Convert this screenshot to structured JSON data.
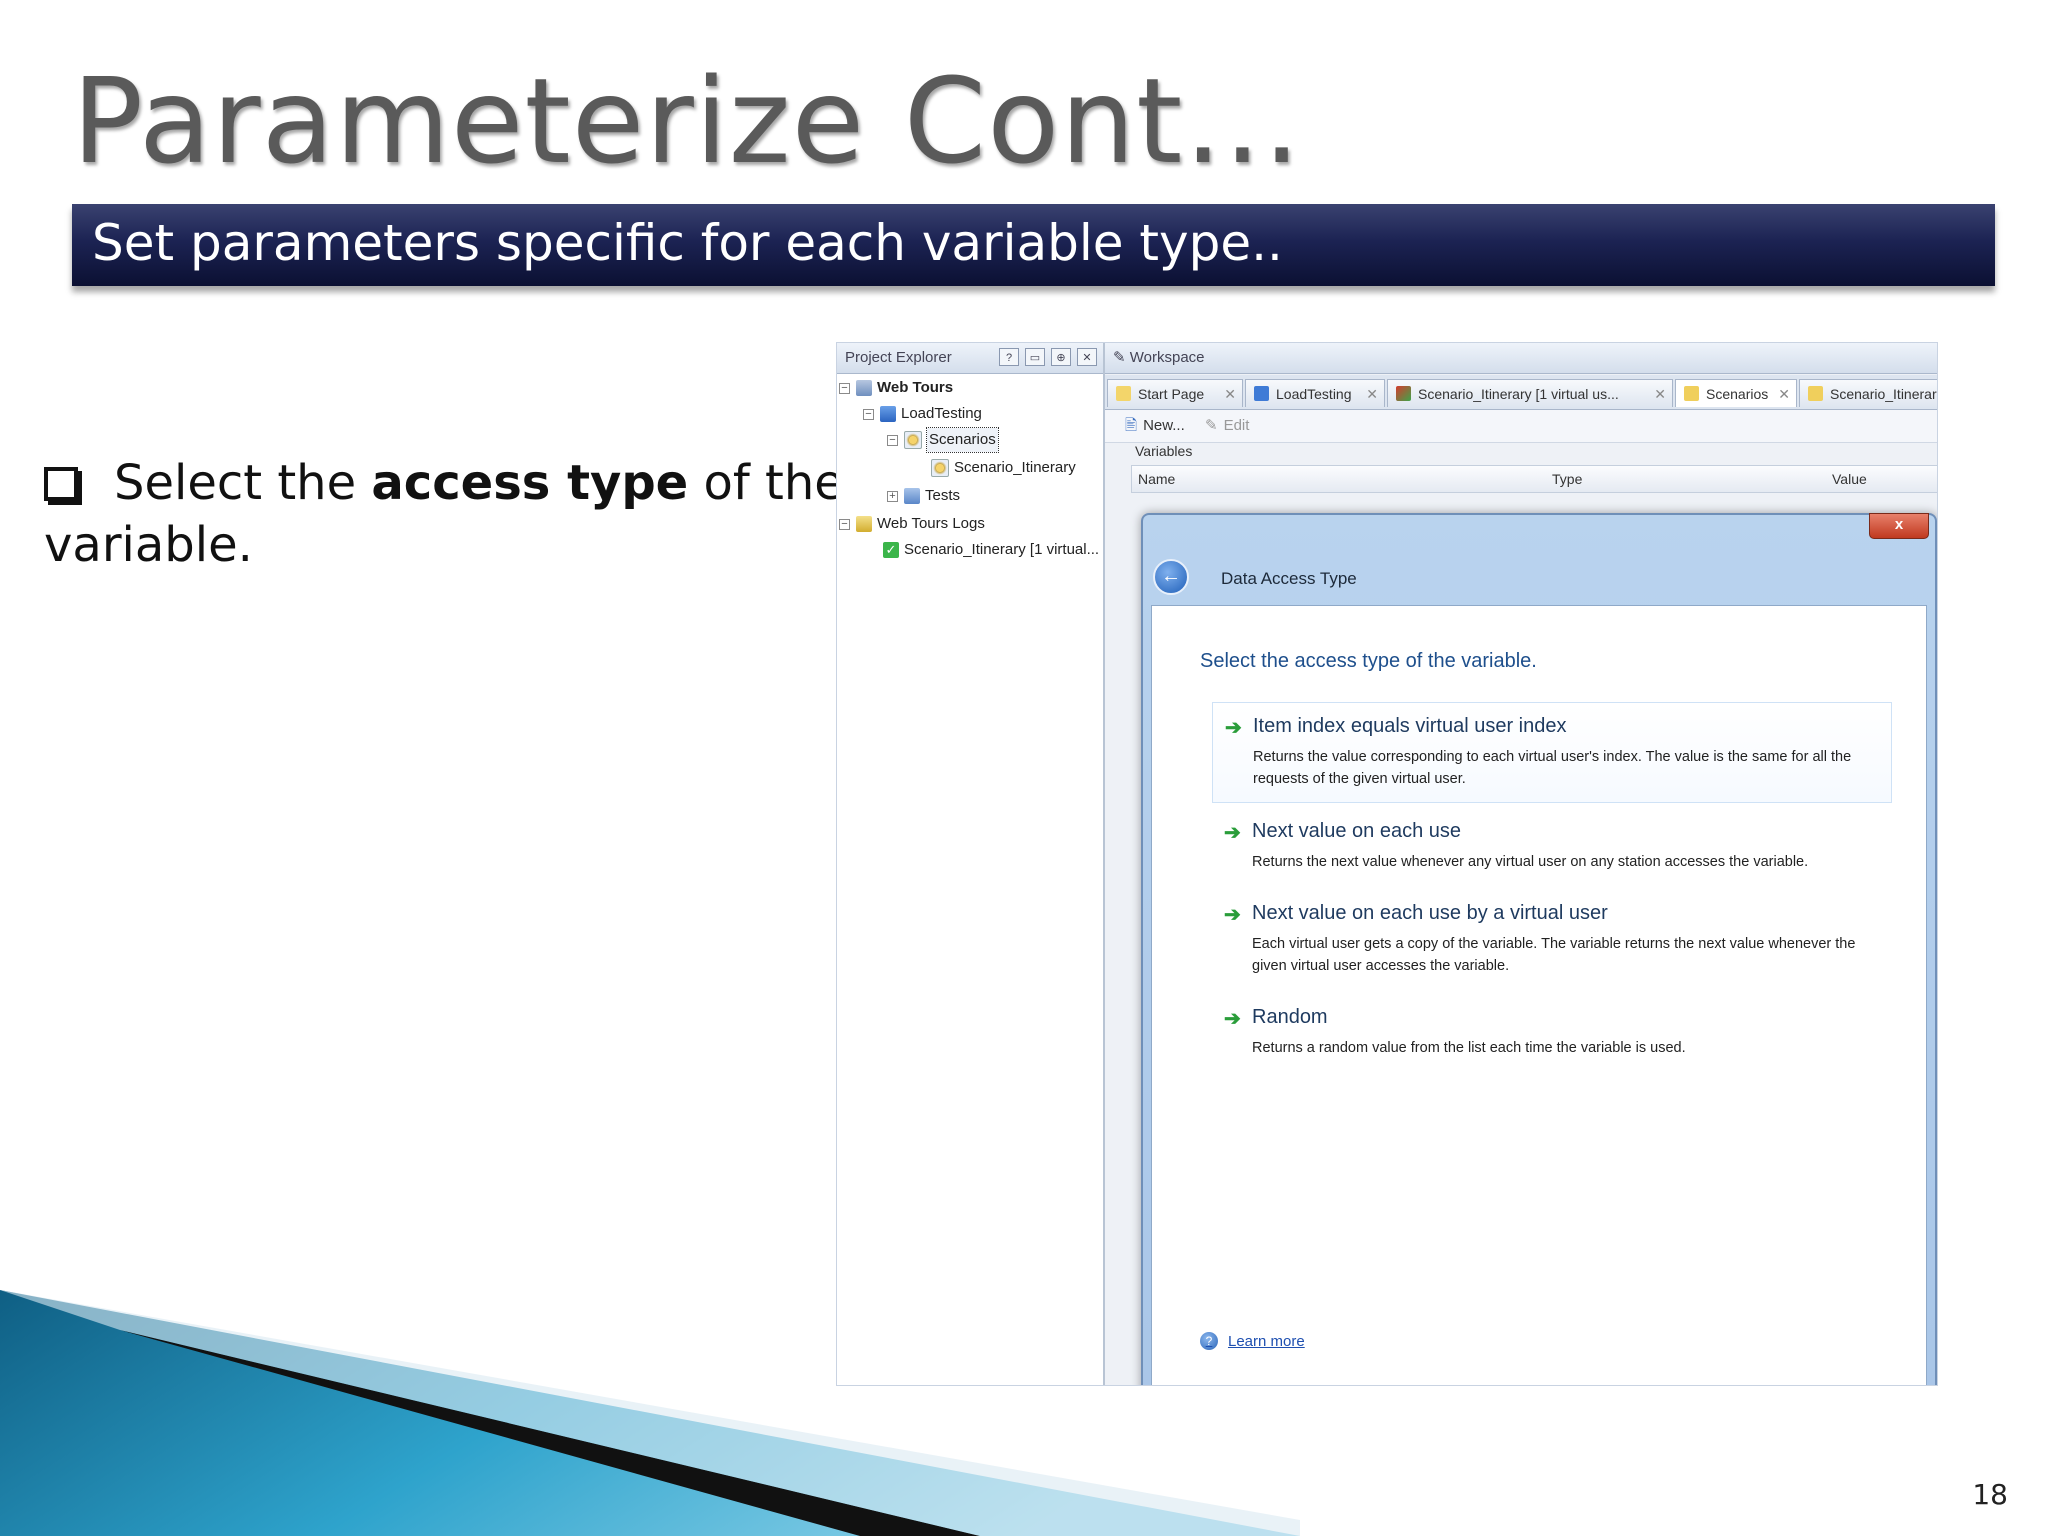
{
  "slide": {
    "title": "Parameterize Cont…",
    "subtitle": "Set parameters specific for each variable type..",
    "bullet": {
      "prefix": "Select the ",
      "bold": "access type",
      "suffix": " of the variable."
    },
    "page_number": "18"
  },
  "explorer": {
    "title": "Project Explorer",
    "buttons": [
      "?",
      "▭",
      "⊕",
      "✕"
    ],
    "tree": {
      "web_tours": "Web Tours",
      "load_testing": "LoadTesting",
      "scenarios": "Scenarios",
      "scenario_itinerary": "Scenario_Itinerary",
      "tests": "Tests",
      "web_tours_logs": "Web Tours Logs",
      "log_item": "Scenario_Itinerary [1 virtual..."
    }
  },
  "workspace": {
    "title": "Workspace",
    "tabs": [
      {
        "label": "Start Page"
      },
      {
        "label": "LoadTesting"
      },
      {
        "label": "Scenario_Itinerary [1 virtual us..."
      },
      {
        "label": "Scenarios"
      },
      {
        "label": "Scenario_Itinerar"
      }
    ],
    "toolbar": {
      "new_label": "New...",
      "edit_label": "Edit"
    },
    "variables_label": "Variables",
    "columns": {
      "name": "Name",
      "type": "Type",
      "value": "Value"
    }
  },
  "dialog": {
    "close_label": "x",
    "title": "Data Access Type",
    "prompt": "Select the access type of the variable.",
    "options": [
      {
        "title": "Item index equals virtual user index",
        "desc": "Returns the value corresponding to each virtual user's index. The value is the same for all the requests of the given virtual user."
      },
      {
        "title": "Next value on each use",
        "desc": "Returns the next value whenever any virtual user on any station accesses the variable."
      },
      {
        "title": "Next value on each use by a virtual user",
        "desc": "Each virtual user gets a copy of the variable. The variable returns the next value whenever the given virtual user accesses the variable."
      },
      {
        "title": "Random",
        "desc": "Returns a random value from the list each time the variable is used."
      }
    ],
    "learn_more": "Learn more"
  },
  "colors": {
    "subtitle_band": "#1c2353",
    "prompt_text": "#1e4f8c",
    "option_arrow": "#2a9d3a"
  }
}
